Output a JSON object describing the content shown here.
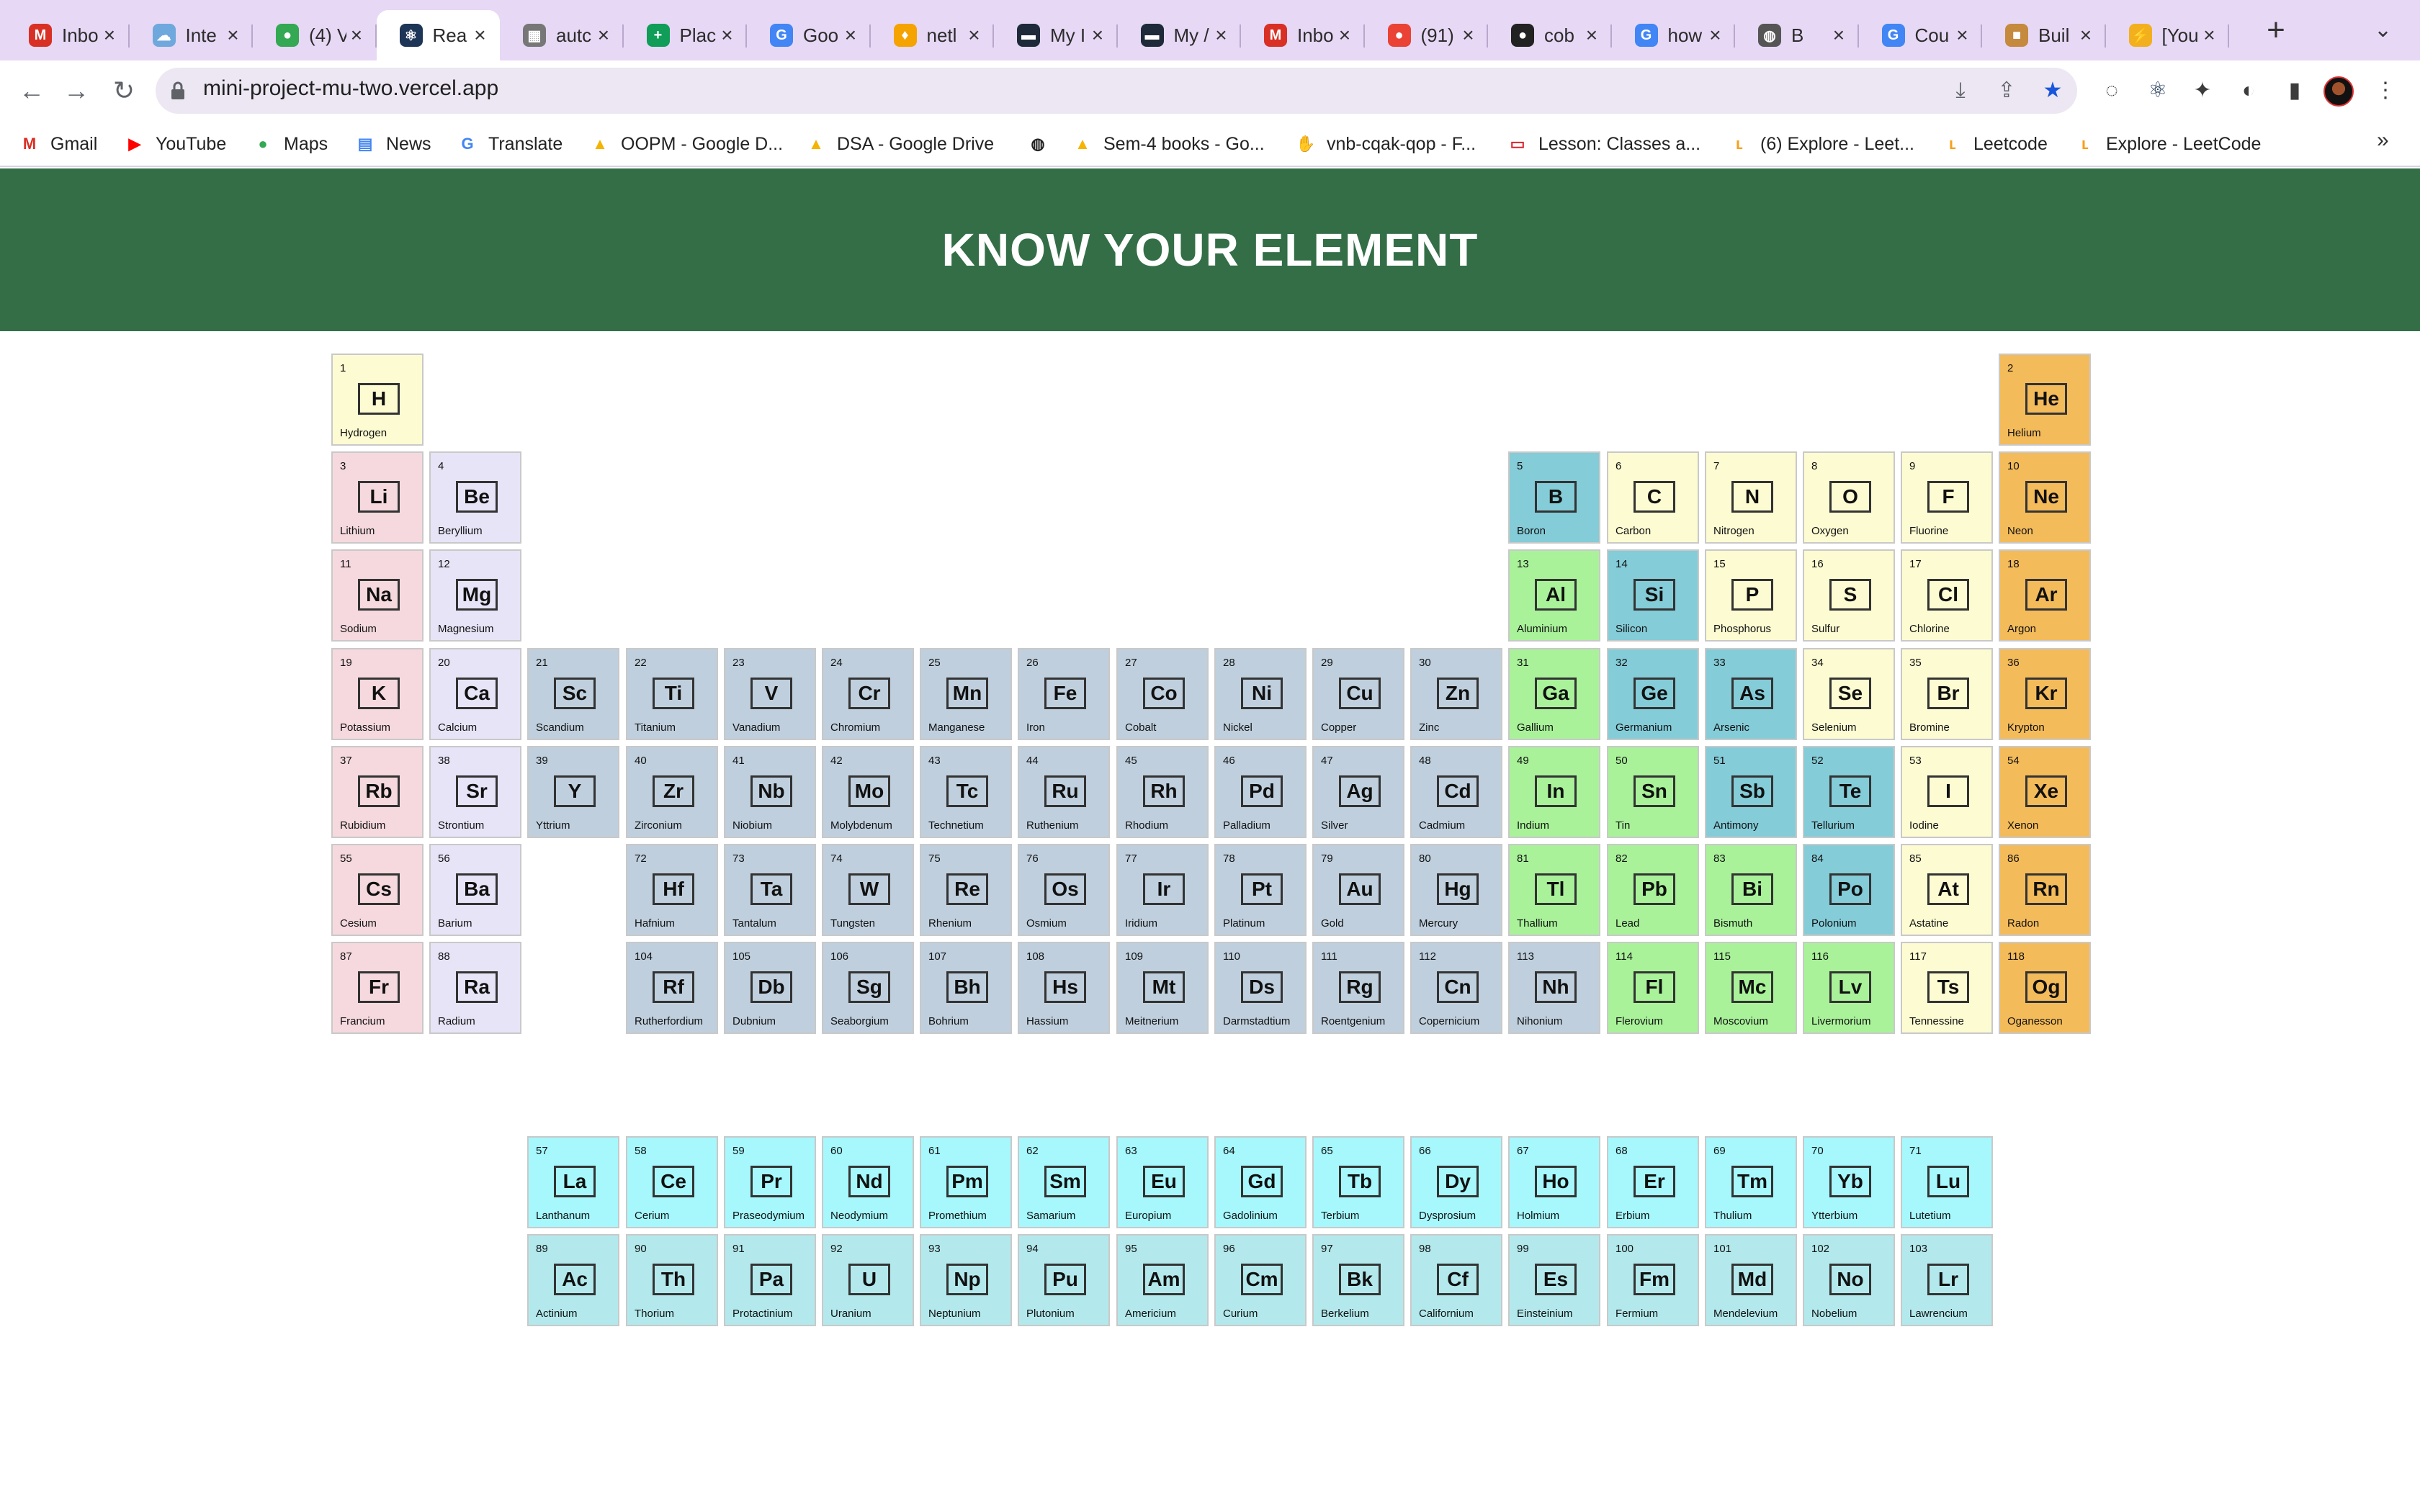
{
  "browser": {
    "tabs": [
      {
        "title": "Inbo",
        "icon": "gmail-icon",
        "color": "#d93025",
        "glyph": "M",
        "active": false
      },
      {
        "title": "Inte",
        "icon": "cloud-icon",
        "color": "#6fa8dc",
        "glyph": "☁",
        "active": false
      },
      {
        "title": "(4) V",
        "icon": "green-app-icon",
        "color": "#34a853",
        "glyph": "●",
        "active": false
      },
      {
        "title": "Rea",
        "icon": "react-icon",
        "color": "#1d3557",
        "glyph": "⚛",
        "active": true
      },
      {
        "title": "autc",
        "icon": "grid-icon",
        "color": "#777777",
        "glyph": "▦",
        "active": false
      },
      {
        "title": "Plac",
        "icon": "sheets-icon",
        "color": "#0f9d58",
        "glyph": "+",
        "active": false
      },
      {
        "title": "Goo",
        "icon": "google-icon",
        "color": "#4285f4",
        "glyph": "G",
        "active": false
      },
      {
        "title": "netl",
        "icon": "flame-icon",
        "color": "#f4a300",
        "glyph": "♦",
        "active": false
      },
      {
        "title": "My I",
        "icon": "terminal-icon",
        "color": "#1e2a3a",
        "glyph": "▬",
        "active": false
      },
      {
        "title": "My /",
        "icon": "terminal-icon",
        "color": "#1e2a3a",
        "glyph": "▬",
        "active": false
      },
      {
        "title": "Inbo",
        "icon": "gmail-icon",
        "color": "#d93025",
        "glyph": "M",
        "active": false
      },
      {
        "title": "(91)",
        "icon": "badge-icon",
        "color": "#ea4335",
        "glyph": "●",
        "active": false
      },
      {
        "title": "cob",
        "icon": "github-icon",
        "color": "#222222",
        "glyph": "●",
        "active": false
      },
      {
        "title": "how",
        "icon": "google-icon",
        "color": "#4285f4",
        "glyph": "G",
        "active": false
      },
      {
        "title": "B",
        "icon": "globe-icon",
        "color": "#555555",
        "glyph": "◍",
        "active": false
      },
      {
        "title": "Cou",
        "icon": "google-icon",
        "color": "#4285f4",
        "glyph": "G",
        "active": false
      },
      {
        "title": "Buil",
        "icon": "box-icon",
        "color": "#c58a3e",
        "glyph": "■",
        "active": false
      },
      {
        "title": "[You",
        "icon": "bolt-icon",
        "color": "#f2b01e",
        "glyph": "⚡",
        "active": false
      }
    ],
    "url": "mini-project-mu-two.vercel.app",
    "bookmarks": [
      {
        "label": "Gmail",
        "icon": "gmail-icon",
        "color": "#d93025",
        "glyph": "M"
      },
      {
        "label": "YouTube",
        "icon": "youtube-icon",
        "color": "#ff0000",
        "glyph": "▶"
      },
      {
        "label": "Maps",
        "icon": "maps-pin-icon",
        "color": "#34a853",
        "glyph": "●"
      },
      {
        "label": "News",
        "icon": "news-icon",
        "color": "#4285f4",
        "glyph": "▤"
      },
      {
        "label": "Translate",
        "icon": "translate-icon",
        "color": "#4285f4",
        "glyph": "G"
      },
      {
        "label": "OOPM - Google D...",
        "icon": "drive-icon",
        "color": "#f4b400",
        "glyph": "▲"
      },
      {
        "label": "DSA - Google Drive",
        "icon": "drive-icon",
        "color": "#f4b400",
        "glyph": "▲"
      },
      {
        "label": "",
        "icon": "globe-icon",
        "color": "#222222",
        "glyph": "◍"
      },
      {
        "label": "Sem-4 books - Go...",
        "icon": "drive-icon",
        "color": "#f4b400",
        "glyph": "▲"
      },
      {
        "label": "vnb-cqak-qop - F...",
        "icon": "hand-icon",
        "color": "#f6c026",
        "glyph": "✋"
      },
      {
        "label": "Lesson: Classes a...",
        "icon": "lesson-icon",
        "color": "#d9262c",
        "glyph": "▭"
      },
      {
        "label": "(6) Explore - Leet...",
        "icon": "leetcode-icon",
        "color": "#f89f1b",
        "glyph": "ʟ"
      },
      {
        "label": "Leetcode",
        "icon": "leetcode-icon",
        "color": "#f89f1b",
        "glyph": "ʟ"
      },
      {
        "label": "Explore - LeetCode",
        "icon": "leetcode-icon",
        "color": "#f89f1b",
        "glyph": "ʟ"
      }
    ]
  },
  "page": {
    "title": "KNOW YOUR ELEMENT"
  },
  "category_colors": {
    "nonmetal": "#fdfbd2",
    "noble": "#f4bb5a",
    "alkali": "#f5d9de",
    "alkaline": "#e8e4f7",
    "transition": "#bfcfdd",
    "metalloid": "#84ccd8",
    "post": "#a9f29a",
    "lanthanide": "#a6f8fd",
    "actinide": "#b3e9ec"
  },
  "elements": [
    {
      "n": 1,
      "s": "H",
      "name": "Hydrogen",
      "r": 1,
      "c": 1,
      "cat": "nonmetal"
    },
    {
      "n": 2,
      "s": "He",
      "name": "Helium",
      "r": 1,
      "c": 18,
      "cat": "noble"
    },
    {
      "n": 3,
      "s": "Li",
      "name": "Lithium",
      "r": 2,
      "c": 1,
      "cat": "alkali"
    },
    {
      "n": 4,
      "s": "Be",
      "name": "Beryllium",
      "r": 2,
      "c": 2,
      "cat": "alkaline"
    },
    {
      "n": 5,
      "s": "B",
      "name": "Boron",
      "r": 2,
      "c": 13,
      "cat": "metalloid"
    },
    {
      "n": 6,
      "s": "C",
      "name": "Carbon",
      "r": 2,
      "c": 14,
      "cat": "nonmetal"
    },
    {
      "n": 7,
      "s": "N",
      "name": "Nitrogen",
      "r": 2,
      "c": 15,
      "cat": "nonmetal"
    },
    {
      "n": 8,
      "s": "O",
      "name": "Oxygen",
      "r": 2,
      "c": 16,
      "cat": "nonmetal"
    },
    {
      "n": 9,
      "s": "F",
      "name": "Fluorine",
      "r": 2,
      "c": 17,
      "cat": "nonmetal"
    },
    {
      "n": 10,
      "s": "Ne",
      "name": "Neon",
      "r": 2,
      "c": 18,
      "cat": "noble"
    },
    {
      "n": 11,
      "s": "Na",
      "name": "Sodium",
      "r": 3,
      "c": 1,
      "cat": "alkali"
    },
    {
      "n": 12,
      "s": "Mg",
      "name": "Magnesium",
      "r": 3,
      "c": 2,
      "cat": "alkaline"
    },
    {
      "n": 13,
      "s": "Al",
      "name": "Aluminium",
      "r": 3,
      "c": 13,
      "cat": "post"
    },
    {
      "n": 14,
      "s": "Si",
      "name": "Silicon",
      "r": 3,
      "c": 14,
      "cat": "metalloid"
    },
    {
      "n": 15,
      "s": "P",
      "name": "Phosphorus",
      "r": 3,
      "c": 15,
      "cat": "nonmetal"
    },
    {
      "n": 16,
      "s": "S",
      "name": "Sulfur",
      "r": 3,
      "c": 16,
      "cat": "nonmetal"
    },
    {
      "n": 17,
      "s": "Cl",
      "name": "Chlorine",
      "r": 3,
      "c": 17,
      "cat": "nonmetal"
    },
    {
      "n": 18,
      "s": "Ar",
      "name": "Argon",
      "r": 3,
      "c": 18,
      "cat": "noble"
    },
    {
      "n": 19,
      "s": "K",
      "name": "Potassium",
      "r": 4,
      "c": 1,
      "cat": "alkali"
    },
    {
      "n": 20,
      "s": "Ca",
      "name": "Calcium",
      "r": 4,
      "c": 2,
      "cat": "alkaline"
    },
    {
      "n": 21,
      "s": "Sc",
      "name": "Scandium",
      "r": 4,
      "c": 3,
      "cat": "transition"
    },
    {
      "n": 22,
      "s": "Ti",
      "name": "Titanium",
      "r": 4,
      "c": 4,
      "cat": "transition"
    },
    {
      "n": 23,
      "s": "V",
      "name": "Vanadium",
      "r": 4,
      "c": 5,
      "cat": "transition"
    },
    {
      "n": 24,
      "s": "Cr",
      "name": "Chromium",
      "r": 4,
      "c": 6,
      "cat": "transition"
    },
    {
      "n": 25,
      "s": "Mn",
      "name": "Manganese",
      "r": 4,
      "c": 7,
      "cat": "transition"
    },
    {
      "n": 26,
      "s": "Fe",
      "name": "Iron",
      "r": 4,
      "c": 8,
      "cat": "transition"
    },
    {
      "n": 27,
      "s": "Co",
      "name": "Cobalt",
      "r": 4,
      "c": 9,
      "cat": "transition"
    },
    {
      "n": 28,
      "s": "Ni",
      "name": "Nickel",
      "r": 4,
      "c": 10,
      "cat": "transition"
    },
    {
      "n": 29,
      "s": "Cu",
      "name": "Copper",
      "r": 4,
      "c": 11,
      "cat": "transition"
    },
    {
      "n": 30,
      "s": "Zn",
      "name": "Zinc",
      "r": 4,
      "c": 12,
      "cat": "transition"
    },
    {
      "n": 31,
      "s": "Ga",
      "name": "Gallium",
      "r": 4,
      "c": 13,
      "cat": "post"
    },
    {
      "n": 32,
      "s": "Ge",
      "name": "Germanium",
      "r": 4,
      "c": 14,
      "cat": "metalloid"
    },
    {
      "n": 33,
      "s": "As",
      "name": "Arsenic",
      "r": 4,
      "c": 15,
      "cat": "metalloid"
    },
    {
      "n": 34,
      "s": "Se",
      "name": "Selenium",
      "r": 4,
      "c": 16,
      "cat": "nonmetal"
    },
    {
      "n": 35,
      "s": "Br",
      "name": "Bromine",
      "r": 4,
      "c": 17,
      "cat": "nonmetal"
    },
    {
      "n": 36,
      "s": "Kr",
      "name": "Krypton",
      "r": 4,
      "c": 18,
      "cat": "noble"
    },
    {
      "n": 37,
      "s": "Rb",
      "name": "Rubidium",
      "r": 5,
      "c": 1,
      "cat": "alkali"
    },
    {
      "n": 38,
      "s": "Sr",
      "name": "Strontium",
      "r": 5,
      "c": 2,
      "cat": "alkaline"
    },
    {
      "n": 39,
      "s": "Y",
      "name": "Yttrium",
      "r": 5,
      "c": 3,
      "cat": "transition"
    },
    {
      "n": 40,
      "s": "Zr",
      "name": "Zirconium",
      "r": 5,
      "c": 4,
      "cat": "transition"
    },
    {
      "n": 41,
      "s": "Nb",
      "name": "Niobium",
      "r": 5,
      "c": 5,
      "cat": "transition"
    },
    {
      "n": 42,
      "s": "Mo",
      "name": "Molybdenum",
      "r": 5,
      "c": 6,
      "cat": "transition"
    },
    {
      "n": 43,
      "s": "Tc",
      "name": "Technetium",
      "r": 5,
      "c": 7,
      "cat": "transition"
    },
    {
      "n": 44,
      "s": "Ru",
      "name": "Ruthenium",
      "r": 5,
      "c": 8,
      "cat": "transition"
    },
    {
      "n": 45,
      "s": "Rh",
      "name": "Rhodium",
      "r": 5,
      "c": 9,
      "cat": "transition"
    },
    {
      "n": 46,
      "s": "Pd",
      "name": "Palladium",
      "r": 5,
      "c": 10,
      "cat": "transition"
    },
    {
      "n": 47,
      "s": "Ag",
      "name": "Silver",
      "r": 5,
      "c": 11,
      "cat": "transition"
    },
    {
      "n": 48,
      "s": "Cd",
      "name": "Cadmium",
      "r": 5,
      "c": 12,
      "cat": "transition"
    },
    {
      "n": 49,
      "s": "In",
      "name": "Indium",
      "r": 5,
      "c": 13,
      "cat": "post"
    },
    {
      "n": 50,
      "s": "Sn",
      "name": "Tin",
      "r": 5,
      "c": 14,
      "cat": "post"
    },
    {
      "n": 51,
      "s": "Sb",
      "name": "Antimony",
      "r": 5,
      "c": 15,
      "cat": "metalloid"
    },
    {
      "n": 52,
      "s": "Te",
      "name": "Tellurium",
      "r": 5,
      "c": 16,
      "cat": "metalloid"
    },
    {
      "n": 53,
      "s": "I",
      "name": "Iodine",
      "r": 5,
      "c": 17,
      "cat": "nonmetal"
    },
    {
      "n": 54,
      "s": "Xe",
      "name": "Xenon",
      "r": 5,
      "c": 18,
      "cat": "noble"
    },
    {
      "n": 55,
      "s": "Cs",
      "name": "Cesium",
      "r": 6,
      "c": 1,
      "cat": "alkali"
    },
    {
      "n": 56,
      "s": "Ba",
      "name": "Barium",
      "r": 6,
      "c": 2,
      "cat": "alkaline"
    },
    {
      "n": 72,
      "s": "Hf",
      "name": "Hafnium",
      "r": 6,
      "c": 4,
      "cat": "transition"
    },
    {
      "n": 73,
      "s": "Ta",
      "name": "Tantalum",
      "r": 6,
      "c": 5,
      "cat": "transition"
    },
    {
      "n": 74,
      "s": "W",
      "name": "Tungsten",
      "r": 6,
      "c": 6,
      "cat": "transition"
    },
    {
      "n": 75,
      "s": "Re",
      "name": "Rhenium",
      "r": 6,
      "c": 7,
      "cat": "transition"
    },
    {
      "n": 76,
      "s": "Os",
      "name": "Osmium",
      "r": 6,
      "c": 8,
      "cat": "transition"
    },
    {
      "n": 77,
      "s": "Ir",
      "name": "Iridium",
      "r": 6,
      "c": 9,
      "cat": "transition"
    },
    {
      "n": 78,
      "s": "Pt",
      "name": "Platinum",
      "r": 6,
      "c": 10,
      "cat": "transition"
    },
    {
      "n": 79,
      "s": "Au",
      "name": "Gold",
      "r": 6,
      "c": 11,
      "cat": "transition"
    },
    {
      "n": 80,
      "s": "Hg",
      "name": "Mercury",
      "r": 6,
      "c": 12,
      "cat": "transition"
    },
    {
      "n": 81,
      "s": "Tl",
      "name": "Thallium",
      "r": 6,
      "c": 13,
      "cat": "post"
    },
    {
      "n": 82,
      "s": "Pb",
      "name": "Lead",
      "r": 6,
      "c": 14,
      "cat": "post"
    },
    {
      "n": 83,
      "s": "Bi",
      "name": "Bismuth",
      "r": 6,
      "c": 15,
      "cat": "post"
    },
    {
      "n": 84,
      "s": "Po",
      "name": "Polonium",
      "r": 6,
      "c": 16,
      "cat": "metalloid"
    },
    {
      "n": 85,
      "s": "At",
      "name": "Astatine",
      "r": 6,
      "c": 17,
      "cat": "nonmetal"
    },
    {
      "n": 86,
      "s": "Rn",
      "name": "Radon",
      "r": 6,
      "c": 18,
      "cat": "noble"
    },
    {
      "n": 87,
      "s": "Fr",
      "name": "Francium",
      "r": 7,
      "c": 1,
      "cat": "alkali"
    },
    {
      "n": 88,
      "s": "Ra",
      "name": "Radium",
      "r": 7,
      "c": 2,
      "cat": "alkaline"
    },
    {
      "n": 104,
      "s": "Rf",
      "name": "Rutherfordium",
      "r": 7,
      "c": 4,
      "cat": "transition"
    },
    {
      "n": 105,
      "s": "Db",
      "name": "Dubnium",
      "r": 7,
      "c": 5,
      "cat": "transition"
    },
    {
      "n": 106,
      "s": "Sg",
      "name": "Seaborgium",
      "r": 7,
      "c": 6,
      "cat": "transition"
    },
    {
      "n": 107,
      "s": "Bh",
      "name": "Bohrium",
      "r": 7,
      "c": 7,
      "cat": "transition"
    },
    {
      "n": 108,
      "s": "Hs",
      "name": "Hassium",
      "r": 7,
      "c": 8,
      "cat": "transition"
    },
    {
      "n": 109,
      "s": "Mt",
      "name": "Meitnerium",
      "r": 7,
      "c": 9,
      "cat": "transition"
    },
    {
      "n": 110,
      "s": "Ds",
      "name": "Darmstadtium",
      "r": 7,
      "c": 10,
      "cat": "transition"
    },
    {
      "n": 111,
      "s": "Rg",
      "name": "Roentgenium",
      "r": 7,
      "c": 11,
      "cat": "transition"
    },
    {
      "n": 112,
      "s": "Cn",
      "name": "Copernicium",
      "r": 7,
      "c": 12,
      "cat": "transition"
    },
    {
      "n": 113,
      "s": "Nh",
      "name": "Nihonium",
      "r": 7,
      "c": 13,
      "cat": "transition"
    },
    {
      "n": 114,
      "s": "Fl",
      "name": "Flerovium",
      "r": 7,
      "c": 14,
      "cat": "post"
    },
    {
      "n": 115,
      "s": "Mc",
      "name": "Moscovium",
      "r": 7,
      "c": 15,
      "cat": "post"
    },
    {
      "n": 116,
      "s": "Lv",
      "name": "Livermorium",
      "r": 7,
      "c": 16,
      "cat": "post"
    },
    {
      "n": 117,
      "s": "Ts",
      "name": "Tennessine",
      "r": 7,
      "c": 17,
      "cat": "nonmetal"
    },
    {
      "n": 118,
      "s": "Og",
      "name": "Oganesson",
      "r": 7,
      "c": 18,
      "cat": "noble"
    },
    {
      "n": 57,
      "s": "La",
      "name": "Lanthanum",
      "r": 9,
      "c": 3,
      "cat": "lanthanide"
    },
    {
      "n": 58,
      "s": "Ce",
      "name": "Cerium",
      "r": 9,
      "c": 4,
      "cat": "lanthanide"
    },
    {
      "n": 59,
      "s": "Pr",
      "name": "Praseodymium",
      "r": 9,
      "c": 5,
      "cat": "lanthanide"
    },
    {
      "n": 60,
      "s": "Nd",
      "name": "Neodymium",
      "r": 9,
      "c": 6,
      "cat": "lanthanide"
    },
    {
      "n": 61,
      "s": "Pm",
      "name": "Promethium",
      "r": 9,
      "c": 7,
      "cat": "lanthanide"
    },
    {
      "n": 62,
      "s": "Sm",
      "name": "Samarium",
      "r": 9,
      "c": 8,
      "cat": "lanthanide"
    },
    {
      "n": 63,
      "s": "Eu",
      "name": "Europium",
      "r": 9,
      "c": 9,
      "cat": "lanthanide"
    },
    {
      "n": 64,
      "s": "Gd",
      "name": "Gadolinium",
      "r": 9,
      "c": 10,
      "cat": "lanthanide"
    },
    {
      "n": 65,
      "s": "Tb",
      "name": "Terbium",
      "r": 9,
      "c": 11,
      "cat": "lanthanide"
    },
    {
      "n": 66,
      "s": "Dy",
      "name": "Dysprosium",
      "r": 9,
      "c": 12,
      "cat": "lanthanide"
    },
    {
      "n": 67,
      "s": "Ho",
      "name": "Holmium",
      "r": 9,
      "c": 13,
      "cat": "lanthanide"
    },
    {
      "n": 68,
      "s": "Er",
      "name": "Erbium",
      "r": 9,
      "c": 14,
      "cat": "lanthanide"
    },
    {
      "n": 69,
      "s": "Tm",
      "name": "Thulium",
      "r": 9,
      "c": 15,
      "cat": "lanthanide"
    },
    {
      "n": 70,
      "s": "Yb",
      "name": "Ytterbium",
      "r": 9,
      "c": 16,
      "cat": "lanthanide"
    },
    {
      "n": 71,
      "s": "Lu",
      "name": "Lutetium",
      "r": 9,
      "c": 17,
      "cat": "lanthanide"
    },
    {
      "n": 89,
      "s": "Ac",
      "name": "Actinium",
      "r": 10,
      "c": 3,
      "cat": "actinide"
    },
    {
      "n": 90,
      "s": "Th",
      "name": "Thorium",
      "r": 10,
      "c": 4,
      "cat": "actinide"
    },
    {
      "n": 91,
      "s": "Pa",
      "name": "Protactinium",
      "r": 10,
      "c": 5,
      "cat": "actinide"
    },
    {
      "n": 92,
      "s": "U",
      "name": "Uranium",
      "r": 10,
      "c": 6,
      "cat": "actinide"
    },
    {
      "n": 93,
      "s": "Np",
      "name": "Neptunium",
      "r": 10,
      "c": 7,
      "cat": "actinide"
    },
    {
      "n": 94,
      "s": "Pu",
      "name": "Plutonium",
      "r": 10,
      "c": 8,
      "cat": "actinide"
    },
    {
      "n": 95,
      "s": "Am",
      "name": "Americium",
      "r": 10,
      "c": 9,
      "cat": "actinide"
    },
    {
      "n": 96,
      "s": "Cm",
      "name": "Curium",
      "r": 10,
      "c": 10,
      "cat": "actinide"
    },
    {
      "n": 97,
      "s": "Bk",
      "name": "Berkelium",
      "r": 10,
      "c": 11,
      "cat": "actinide"
    },
    {
      "n": 98,
      "s": "Cf",
      "name": "Californium",
      "r": 10,
      "c": 12,
      "cat": "actinide"
    },
    {
      "n": 99,
      "s": "Es",
      "name": "Einsteinium",
      "r": 10,
      "c": 13,
      "cat": "actinide"
    },
    {
      "n": 100,
      "s": "Fm",
      "name": "Fermium",
      "r": 10,
      "c": 14,
      "cat": "actinide"
    },
    {
      "n": 101,
      "s": "Md",
      "name": "Mendelevium",
      "r": 10,
      "c": 15,
      "cat": "actinide"
    },
    {
      "n": 102,
      "s": "No",
      "name": "Nobelium",
      "r": 10,
      "c": 16,
      "cat": "actinide"
    },
    {
      "n": 103,
      "s": "Lr",
      "name": "Lawrencium",
      "r": 10,
      "c": 17,
      "cat": "actinide"
    }
  ]
}
